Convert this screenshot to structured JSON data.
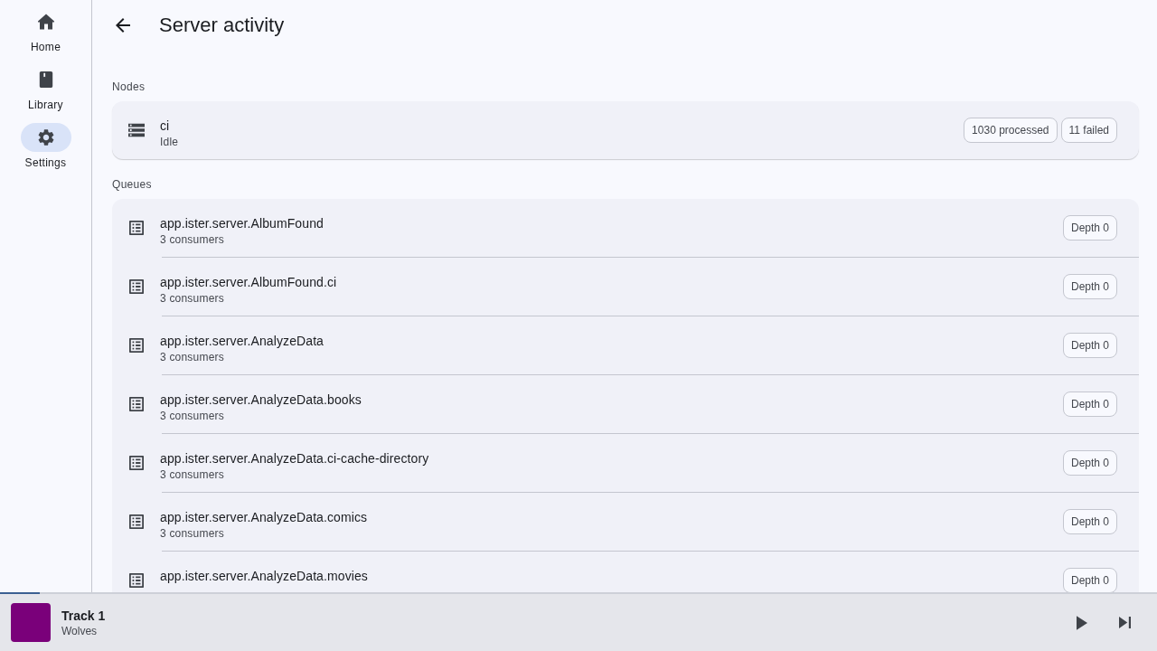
{
  "nav": [
    {
      "label": "Home",
      "selected": false
    },
    {
      "label": "Library",
      "selected": false
    },
    {
      "label": "Settings",
      "selected": true
    }
  ],
  "header": {
    "title": "Server activity"
  },
  "nodes": {
    "heading": "Nodes",
    "items": [
      {
        "name": "ci",
        "status": "Idle",
        "chips": [
          "1030 processed",
          "11 failed"
        ]
      }
    ]
  },
  "queues": {
    "heading": "Queues",
    "items": [
      {
        "name": "app.ister.server.AlbumFound",
        "subtitle": "3 consumers",
        "chip": "Depth 0"
      },
      {
        "name": "app.ister.server.AlbumFound.ci",
        "subtitle": "3 consumers",
        "chip": "Depth 0"
      },
      {
        "name": "app.ister.server.AnalyzeData",
        "subtitle": "3 consumers",
        "chip": "Depth 0"
      },
      {
        "name": "app.ister.server.AnalyzeData.books",
        "subtitle": "3 consumers",
        "chip": "Depth 0"
      },
      {
        "name": "app.ister.server.AnalyzeData.ci-cache-directory",
        "subtitle": "3 consumers",
        "chip": "Depth 0"
      },
      {
        "name": "app.ister.server.AnalyzeData.comics",
        "subtitle": "3 consumers",
        "chip": "Depth 0"
      },
      {
        "name": "app.ister.server.AnalyzeData.movies",
        "chip": "Depth 0"
      }
    ]
  },
  "player": {
    "title": "Track 1",
    "artist": "Wolves",
    "progress": {
      "level": 0.034
    }
  }
}
